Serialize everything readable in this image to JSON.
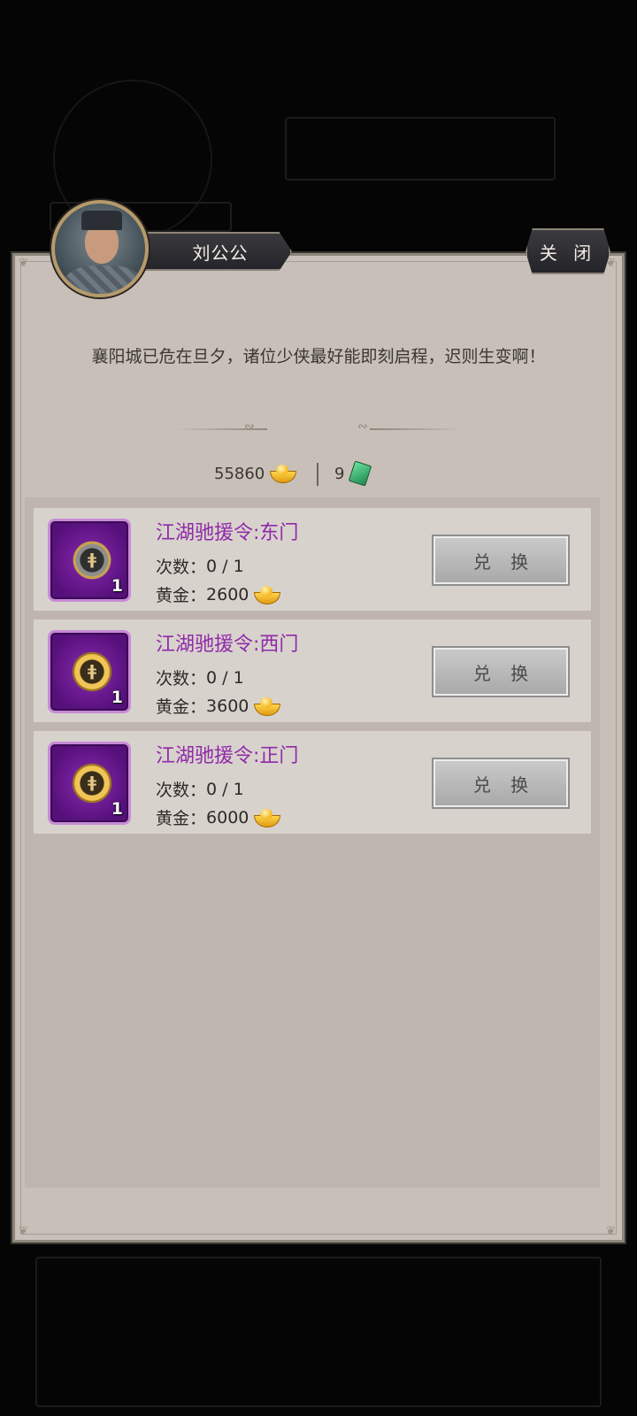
{
  "npc": {
    "name": "刘公公"
  },
  "close_label": "关 闭",
  "message": "襄阳城已危在旦夕，诸位少侠最好能即刻启程，迟则生变啊！",
  "currency": {
    "gold": "55860",
    "jade": "9"
  },
  "items": [
    {
      "title": "江湖驰援令:东门",
      "count": "1",
      "times_label": "次数：",
      "times_value": "0 / 1",
      "price_label": "黄金：",
      "price_value": "2600",
      "button": "兑 换"
    },
    {
      "title": "江湖驰援令:西门",
      "count": "1",
      "times_label": "次数：",
      "times_value": "0 / 1",
      "price_label": "黄金：",
      "price_value": "3600",
      "button": "兑 换"
    },
    {
      "title": "江湖驰援令:正门",
      "count": "1",
      "times_label": "次数：",
      "times_value": "0 / 1",
      "price_label": "黄金：",
      "price_value": "6000",
      "button": "兑 换"
    }
  ]
}
